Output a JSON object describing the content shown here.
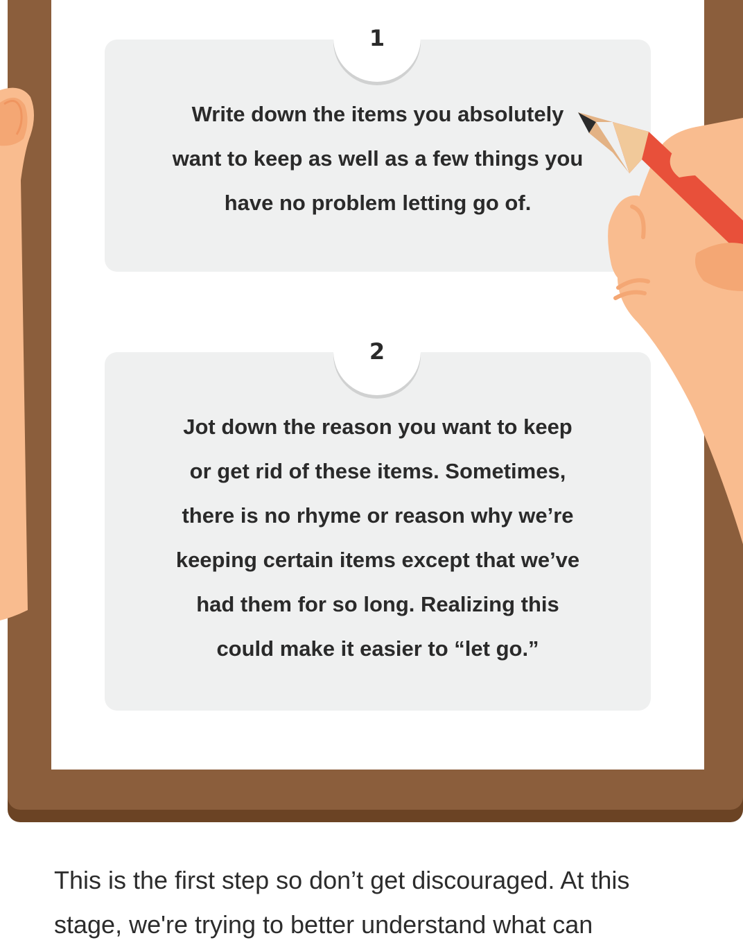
{
  "steps": [
    {
      "number": "1",
      "text": "Write down the items you absolutely\nwant to keep as well as a few things you\nhave no problem letting go of."
    },
    {
      "number": "2",
      "text": "Jot down the reason you want to keep\nor get rid of these items. Sometimes,\nthere is no rhyme or reason why we’re\nkeeping certain items except that we’ve\nhad them for so long. Realizing this\ncould make it easier to “let go.”"
    }
  ],
  "body": {
    "paragraph": "This is the first step so don’t get discouraged.  At this\nstage, we're trying to better understand what can"
  },
  "illustration": {
    "left_hand": "left-hand-holding-clipboard",
    "right_hand": "right-hand-writing-with-pencil",
    "pencil_color": "#e8503a",
    "skin_color": "#f9bc8f",
    "board_color": "#8b5e3c"
  }
}
